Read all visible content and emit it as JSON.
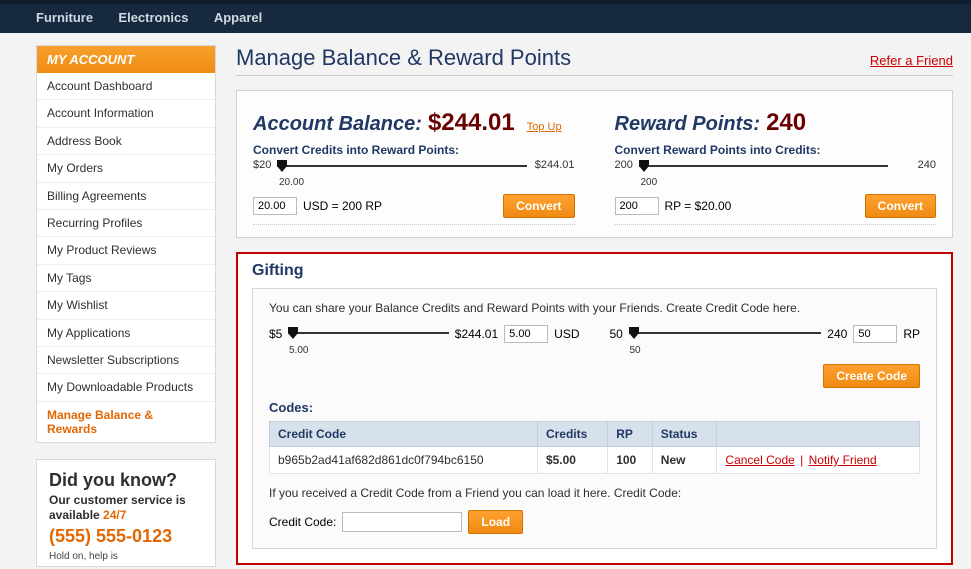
{
  "topnav": {
    "items": [
      "Furniture",
      "Electronics",
      "Apparel"
    ]
  },
  "sidebar": {
    "title": "MY ACCOUNT",
    "items": [
      "Account Dashboard",
      "Account Information",
      "Address Book",
      "My Orders",
      "Billing Agreements",
      "Recurring Profiles",
      "My Product Reviews",
      "My Tags",
      "My Wishlist",
      "My Applications",
      "Newsletter Subscriptions",
      "My Downloadable Products",
      "Manage Balance & Rewards"
    ],
    "activeIndex": 12
  },
  "dyk": {
    "heading": "Did you know?",
    "sub_pre": "Our customer service is available ",
    "sub_orange": "24/7",
    "phone": "(555) 555-0123",
    "hold": "Hold on, help is"
  },
  "page": {
    "title": "Manage Balance & Reward Points",
    "refer": "Refer a Friend"
  },
  "balance": {
    "left": {
      "label": "Account Balance:",
      "value": "$244.01",
      "topup": "Top Up",
      "convert_label": "Convert Credits into Reward Points:",
      "min": "$20",
      "max": "$244.01",
      "under": "20.00",
      "input": "20.00",
      "hint": "USD = 200 RP",
      "button": "Convert"
    },
    "right": {
      "label": "Reward Points:",
      "value": "240",
      "convert_label": "Convert Reward Points into Credits:",
      "min": "200",
      "max": "240",
      "under": "200",
      "input": "200",
      "hint": "RP = $20.00",
      "button": "Convert"
    }
  },
  "gifting": {
    "title": "Gifting",
    "intro": "You can share your Balance Credits and Reward Points with your Friends. Create Credit Code here.",
    "usd": {
      "min": "$5",
      "max": "$244.01",
      "under": "5.00",
      "input": "5.00",
      "unit": "USD"
    },
    "rp": {
      "min": "50",
      "max": "240",
      "under": "50",
      "input": "50",
      "unit": "RP"
    },
    "create": "Create Code",
    "codes_heading": "Codes:",
    "table": {
      "headers": [
        "Credit Code",
        "Credits",
        "RP",
        "Status",
        ""
      ],
      "row": {
        "code": "b965b2ad41af682d861dc0f794bc6150",
        "credits": "$5.00",
        "rp": "100",
        "status": "New",
        "cancel": "Cancel Code",
        "notify": "Notify Friend"
      }
    },
    "received": "If you received a Credit Code from a Friend you can load it here. Credit Code:",
    "load_label": "Credit Code:",
    "load_button": "Load"
  }
}
